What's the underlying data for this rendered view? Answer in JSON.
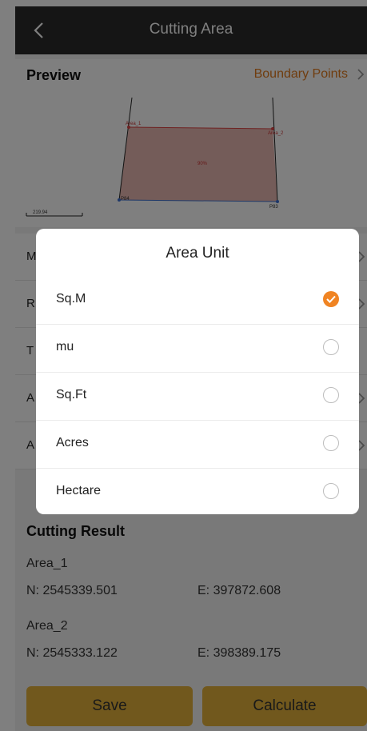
{
  "header": {
    "title": "Cutting Area"
  },
  "preview": {
    "heading": "Preview",
    "boundary_link": "Boundary Points",
    "labels": {
      "p1": "Area_1",
      "p2": "Area_2",
      "p3": "P84",
      "p4": "P83",
      "center": "90%",
      "scale": "219.94"
    }
  },
  "rows": [
    {
      "letter": "M"
    },
    {
      "letter": "R"
    },
    {
      "letter": "T"
    },
    {
      "letter": "A"
    },
    {
      "letter": "A"
    }
  ],
  "cutting_result": {
    "heading": "Cutting Result",
    "items": [
      {
        "name": "Area_1",
        "n": "N: 2545339.501",
        "e": "E: 397872.608"
      },
      {
        "name": "Area_2",
        "n": "N: 2545333.122",
        "e": "E: 398389.175"
      }
    ]
  },
  "buttons": {
    "save": "Save",
    "calculate": "Calculate"
  },
  "dialog": {
    "title": "Area Unit",
    "selected": "Sq.M",
    "options": [
      "Sq.M",
      "mu",
      "Sq.Ft",
      "Acres",
      "Hectare"
    ]
  },
  "colors": {
    "accent": "#f08423",
    "button": "#e3b13a",
    "header": "#2a2a2a",
    "polygon_fill": "#e8b9b3"
  }
}
